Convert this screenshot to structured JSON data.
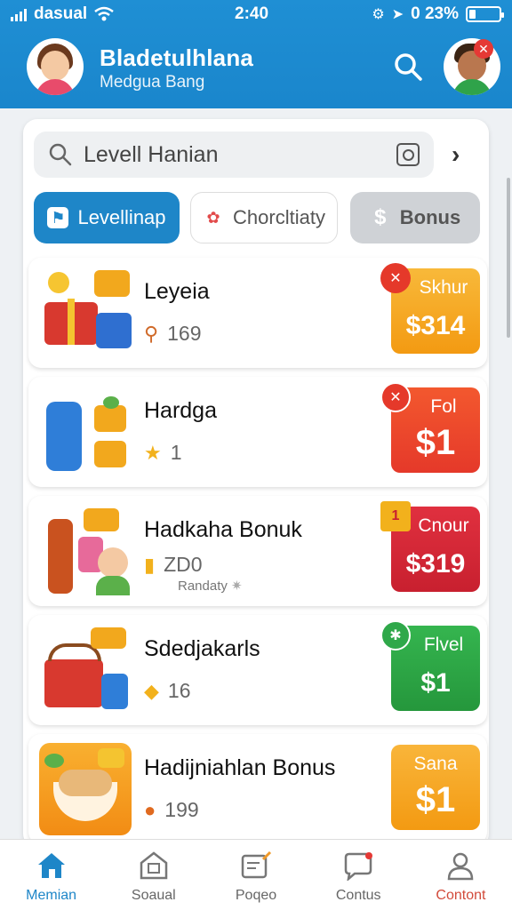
{
  "status": {
    "carrier": "dasual",
    "time": "2:40",
    "battery": "0 23%",
    "battery_level": 0.23
  },
  "header": {
    "title": "Bladetulhlana",
    "subtitle": "Medgua Bang"
  },
  "search": {
    "value": "Levell Hanian"
  },
  "tabs": [
    {
      "label": "Levellinap",
      "icon": "flag-icon"
    },
    {
      "label": "Chorcltiaty",
      "icon": "candy-icon"
    },
    {
      "label": "Bonus",
      "icon": "dollar-icon"
    }
  ],
  "items": [
    {
      "name": "Leyeia",
      "value": "169",
      "sub": "",
      "badge_label": "Skhur",
      "badge_price": "$314",
      "badge_color": "#f6a21a"
    },
    {
      "name": "Hardga",
      "value": "1",
      "sub": "",
      "badge_label": "Fol",
      "badge_price": "$1",
      "badge_color": "#ef4a28"
    },
    {
      "name": "Hadkaha Bonuk",
      "value": "ZD0",
      "sub": "Randaty",
      "badge_label": "Cnour",
      "badge_price": "$319",
      "badge_color": "#d92a3a"
    },
    {
      "name": "Sdedjakarls",
      "value": "16",
      "sub": "",
      "badge_label": "Flvel",
      "badge_price": "$1",
      "badge_color": "#2fa84a"
    },
    {
      "name": "Hadijniahlan Bonus",
      "value": "199",
      "sub": "",
      "badge_label": "Sana",
      "badge_price": "$1",
      "badge_color": "#f7a31c"
    }
  ],
  "nav": [
    {
      "label": "Memian",
      "icon": "home-icon"
    },
    {
      "label": "Soaual",
      "icon": "store-icon"
    },
    {
      "label": "Poqeo",
      "icon": "edit-note-icon"
    },
    {
      "label": "Contus",
      "icon": "chat-icon"
    },
    {
      "label": "Contont",
      "icon": "profile-icon"
    }
  ],
  "colors": {
    "primary": "#1e86c8",
    "header": "#1f8fd4"
  }
}
